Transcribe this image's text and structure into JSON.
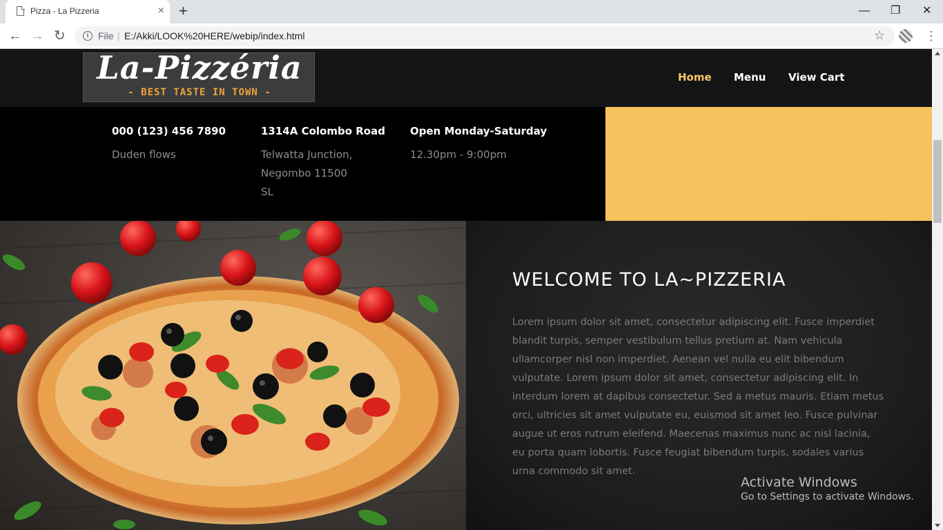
{
  "browser": {
    "tab_title": "Pizza - La Pizzeria",
    "tab_close": "×",
    "new_tab": "+",
    "minimize": "—",
    "maximize": "❐",
    "close": "✕",
    "back": "←",
    "forward": "→",
    "reload": "↻",
    "info": "i",
    "scheme_label": "File",
    "separator": "|",
    "url": "E:/Akki/LOOK%20HERE/webip/index.html",
    "bookmark": "☆",
    "menu": "⋮"
  },
  "site": {
    "logo_word": "La-Pizzéria",
    "logo_tagline": "- BEST TASTE IN TOWN -",
    "nav": [
      {
        "label": "Home",
        "active": true
      },
      {
        "label": "Menu",
        "active": false
      },
      {
        "label": "View Cart",
        "active": false
      }
    ],
    "accent_color": "#fac564",
    "gold_color": "#f6c25d"
  },
  "info": {
    "phone": {
      "head": "000 (123) 456 7890",
      "lines": [
        "Duden flows"
      ]
    },
    "address": {
      "head": "1314A Colombo Road",
      "lines": [
        "Telwatta Junction,",
        "Negombo 11500",
        "SL"
      ]
    },
    "hours": {
      "head": "Open Monday-Saturday",
      "lines": [
        "12.30pm - 9:00pm"
      ]
    }
  },
  "about": {
    "heading": "WELCOME TO LA~PIZZERIA",
    "body": "Lorem ipsum dolor sit amet, consectetur adipiscing elit. Fusce imperdiet blandit turpis, semper vestibulum tellus pretium at. Nam vehicula ullamcorper nisl non imperdiet. Aenean vel nulla eu elit bibendum vulputate. Lorem ipsum dolor sit amet, consectetur adipiscing elit. In interdum lorem at dapibus consectetur. Sed a metus mauris. Etiam metus orci, ultricies sit amet vulputate eu, euismod sit amet leo. Fusce pulvinar augue ut eros rutrum eleifend. Maecenas maximus nunc ac nisl lacinia, eu porta quam lobortis. Fusce feugiat bibendum turpis, sodales varius urna commodo sit amet."
  },
  "watermark": {
    "title": "Activate Windows",
    "subtitle": "Go to Settings to activate Windows."
  },
  "hero_image": {
    "icon": "pizza-photo"
  }
}
